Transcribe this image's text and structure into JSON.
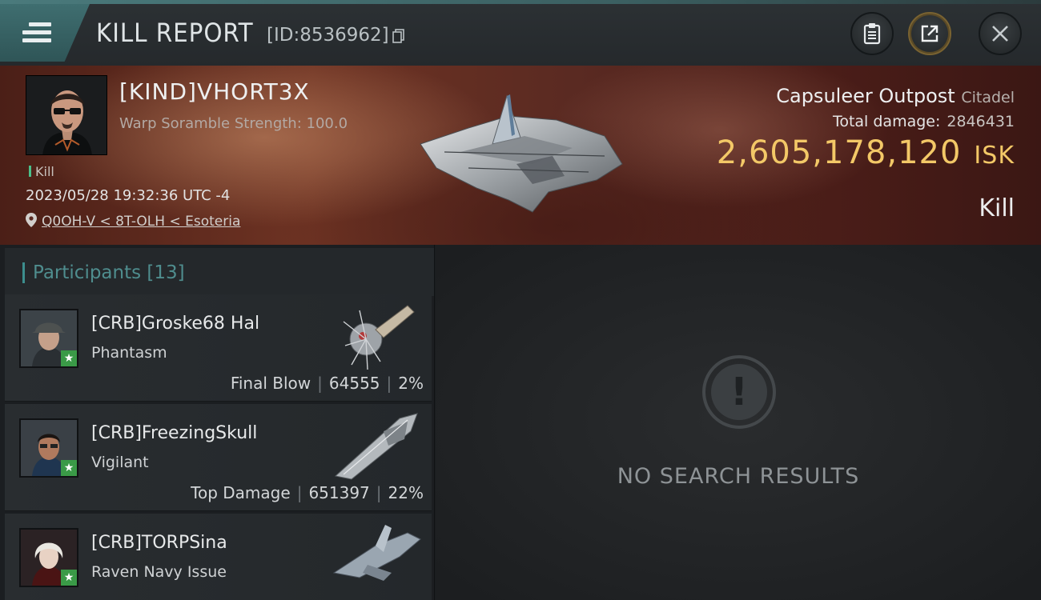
{
  "header": {
    "title": "KILL REPORT",
    "report_id": "[ID:8536962]"
  },
  "victim": {
    "name": "[KIND]VHORT3X",
    "subtitle": "Warp Soramble Strength: 100.0",
    "tag": "Kill",
    "timestamp": "2023/05/28 19:32:36 UTC -4",
    "location": "Q0OH-V < 8T-OLH < Esoteria"
  },
  "target": {
    "name": "Capsuleer Outpost",
    "class": "Citadel",
    "total_damage_label": "Total damage:",
    "total_damage_value": "2846431",
    "isk_value": "2,605,178,120",
    "isk_unit": "ISK",
    "result": "Kill"
  },
  "participants": {
    "label": "Participants",
    "count": "[13]",
    "rows": [
      {
        "name": "[CRB]Groske68 Hal",
        "ship": "Phantasm",
        "role": "Final Blow",
        "damage": "64555",
        "percent": "2%"
      },
      {
        "name": "[CRB]FreezingSkull",
        "ship": "Vigilant",
        "role": "Top Damage",
        "damage": "651397",
        "percent": "22%"
      },
      {
        "name": "[CRB]TORPSina",
        "ship": "Raven Navy Issue",
        "role": "",
        "damage": "",
        "percent": ""
      }
    ]
  },
  "search": {
    "empty_text": "NO SEARCH RESULTS"
  },
  "colors": {
    "accent_teal": "#3c8e8e",
    "isk_gold": "#f3c867",
    "badge_green": "#3a9a47"
  },
  "icons": [
    "menu-icon",
    "copy-icon",
    "clipboard-icon",
    "share-icon",
    "close-icon",
    "location-pin-icon",
    "star-icon",
    "exclamation-icon"
  ]
}
